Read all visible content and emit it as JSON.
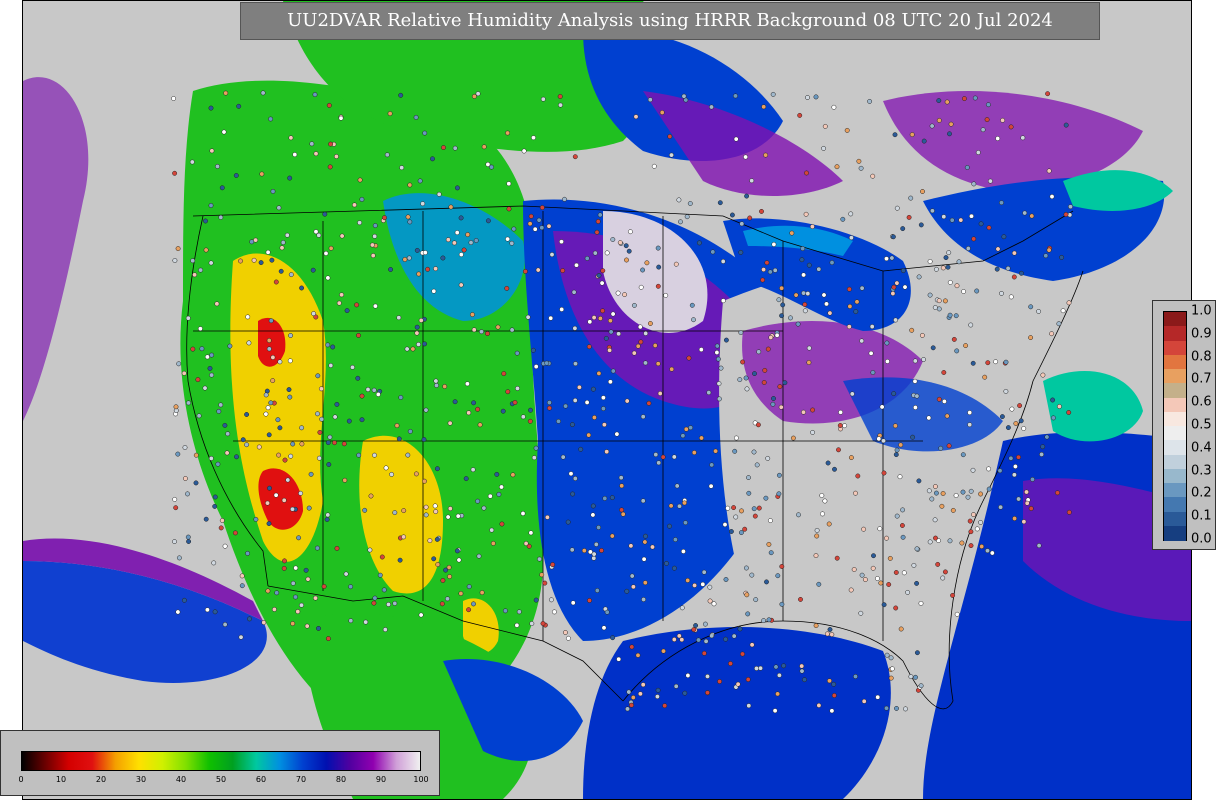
{
  "title": "UU2DVAR Relative Humidity Analysis using HRRR Background 08 UTC 20 Jul 2024",
  "rh_colorbar": {
    "ticks": [
      "0",
      "10",
      "20",
      "30",
      "40",
      "50",
      "60",
      "70",
      "80",
      "90",
      "100"
    ],
    "stops": [
      "#000000",
      "#6b0000",
      "#d40000",
      "#e01010",
      "#f4a000",
      "#ffe000",
      "#d0f000",
      "#80e000",
      "#10c000",
      "#00a020",
      "#00c8a0",
      "#0090e0",
      "#0040d0",
      "#0010b0",
      "#5000a0",
      "#9000b0",
      "#d0a0d8",
      "#f0f0f0"
    ]
  },
  "ratio_colorbar": {
    "ticks": [
      "1.0",
      "0.9",
      "0.8",
      "0.7",
      "0.6",
      "0.5",
      "0.4",
      "0.3",
      "0.2",
      "0.1",
      "0.0"
    ],
    "colors": [
      "#8b1a1a",
      "#b52828",
      "#d4453a",
      "#e2753f",
      "#e8a060",
      "#c4b08a",
      "#f4c8b8",
      "#f8e8e0",
      "#eeeeee",
      "#dde4ea",
      "#c0d0dc",
      "#98b8cc",
      "#6a98c0",
      "#4478b0",
      "#2a5a98",
      "#163e80"
    ]
  },
  "map": {
    "dry_color": "#f0d000",
    "very_dry_color": "#e01010",
    "mid_color": "#20c020",
    "moist_color": "#0070d8",
    "wet_color": "#0020c0",
    "very_wet_color": "#8010b0",
    "saturated_color": "#e0d0e8",
    "ocean_color": "#c8c8c8"
  }
}
